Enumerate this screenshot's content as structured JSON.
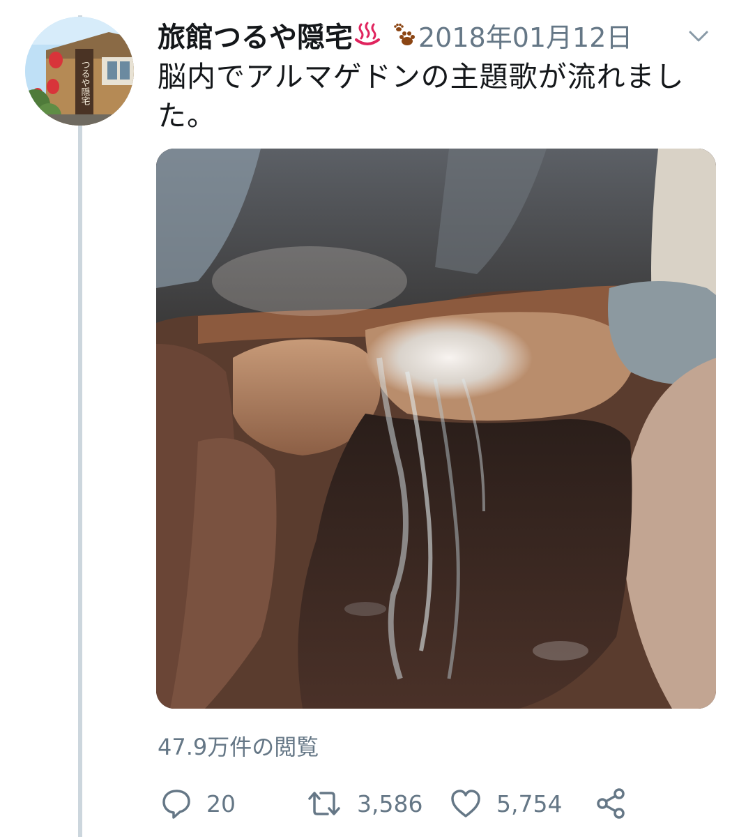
{
  "tweet": {
    "display_name": "旅館つるや隠宅",
    "date": "2018年01月12日",
    "text": "脳内でアルマゲドンの主題歌が流れました。",
    "views": "47.9万件の閲覧",
    "avatar_sign_text": "つるや隠宅"
  },
  "actions": {
    "reply_count": "20",
    "retweet_count": "3,586",
    "like_count": "5,754"
  },
  "icons": {
    "name_emoji_1": "hot-springs-emoji",
    "name_emoji_2": "paw-prints-emoji",
    "menu": "chevron-down-icon",
    "reply": "reply-bubble-icon",
    "retweet": "retweet-icon",
    "like": "heart-icon",
    "share": "share-icon"
  },
  "colors": {
    "text_primary": "#14171a",
    "text_secondary": "#657786",
    "thread_line": "#ccd6dd",
    "hot_spring_red": "#e0245e"
  }
}
